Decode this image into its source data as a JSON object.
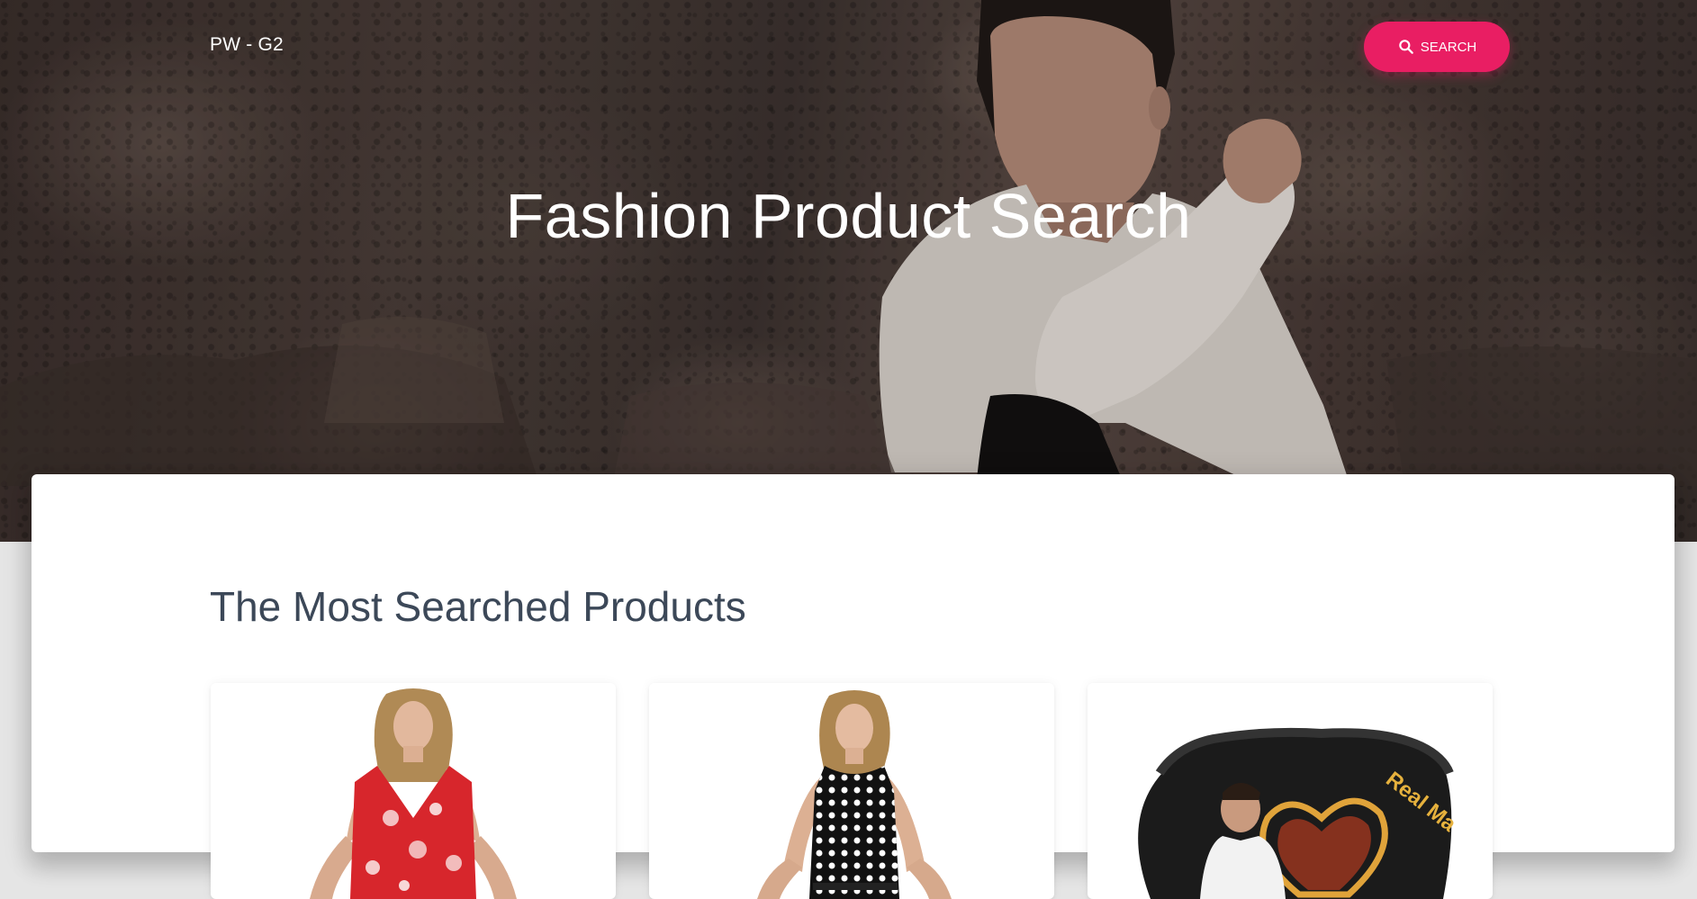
{
  "navbar": {
    "brand": "PW - G2",
    "search_label": "SEARCH"
  },
  "hero": {
    "title": "Fashion Product Search"
  },
  "main": {
    "section_title": "The Most Searched Products",
    "products": [
      {
        "image": "red-floral-dress-model"
      },
      {
        "image": "black-polka-dot-dress-model"
      },
      {
        "image": "real-madrid-bag"
      }
    ]
  },
  "colors": {
    "accent": "#e91e63",
    "heading": "#3c4858",
    "background": "#e5e5e5",
    "card": "#ffffff"
  }
}
